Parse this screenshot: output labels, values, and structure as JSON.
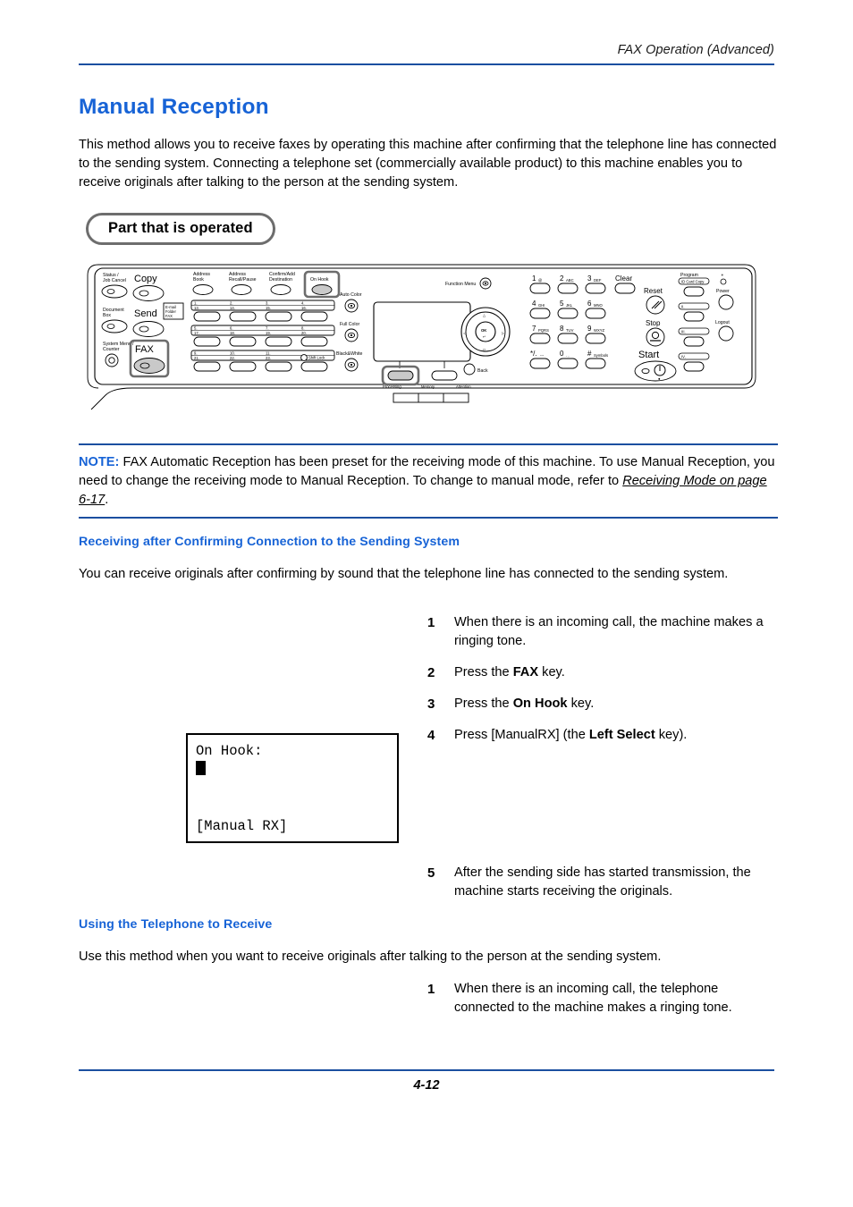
{
  "header": {
    "title": "FAX Operation (Advanced)"
  },
  "page_title": "Manual Reception",
  "intro": "This method allows you to receive faxes by operating this machine after confirming that the telephone line has connected to the sending system. Connecting a telephone set (commercially available product) to this machine enables you to receive originals after talking to the person at the sending system.",
  "callout": {
    "label": "Part that is operated"
  },
  "note": {
    "label": "NOTE:",
    "text_before": " FAX Automatic Reception has been preset for the receiving mode of this machine. To use Manual Reception, you need to change the receiving mode to Manual Reception. To change to manual mode, refer to ",
    "reference": "Receiving Mode on page 6-17",
    "text_after": "."
  },
  "sections": [
    {
      "heading": "Receiving after Confirming Connection to the Sending System",
      "body": "You can receive originals after confirming by sound that the telephone line has connected to the sending system."
    },
    {
      "heading": "Using the Telephone to Receive",
      "body": "Use this method when you want to receive originals after talking to the person at the sending system."
    }
  ],
  "steps_group_1": [
    {
      "num": "1",
      "parts": [
        {
          "text": "When there is an incoming call, the machine makes a ringing tone.",
          "bold": false
        }
      ]
    },
    {
      "num": "2",
      "parts": [
        {
          "text": "Press the ",
          "bold": false
        },
        {
          "text": "FAX",
          "bold": true
        },
        {
          "text": " key.",
          "bold": false
        }
      ]
    },
    {
      "num": "3",
      "parts": [
        {
          "text": "Press the ",
          "bold": false
        },
        {
          "text": "On Hook",
          "bold": true
        },
        {
          "text": " key.",
          "bold": false
        }
      ]
    },
    {
      "num": "4",
      "parts": [
        {
          "text": "Press [ManualRX] (the ",
          "bold": false
        },
        {
          "text": "Left Select",
          "bold": true
        },
        {
          "text": " key).",
          "bold": false
        }
      ]
    }
  ],
  "steps_group_2": [
    {
      "num": "5",
      "parts": [
        {
          "text": "After the sending side has started transmission, the machine starts receiving the originals.",
          "bold": false
        }
      ]
    }
  ],
  "steps_group_3": [
    {
      "num": "1",
      "parts": [
        {
          "text": "When there is an incoming call, the telephone connected to the machine makes a ringing tone.",
          "bold": false
        }
      ]
    }
  ],
  "lcd": {
    "line1": "On Hook:",
    "cursor": true,
    "bottom": "[Manual RX]"
  },
  "control_panel": {
    "labels": {
      "status_job_cancel": "Status /\nJob Cancel",
      "document_box": "Document\nBox",
      "system_menu_counter": "System Menu /\nCounter",
      "copy": "Copy",
      "send": "Send",
      "fax": "FAX",
      "send_tag": "E-mail\nFolder\nFAX",
      "address_book": "Address\nBook",
      "address_recall_pause": "Address\nRecall/Pause",
      "confirm_add_destination": "Confirm/Add\nDestination",
      "on_hook": "On Hook",
      "shift_lock": "Shift Lock",
      "auto_color": "Auto Color",
      "full_color": "Full Color",
      "black_white": "Black&White",
      "processing": "Processing",
      "memory": "Memory",
      "attention": "Attention",
      "function_menu": "Function Menu",
      "ok": "OK",
      "back": "Back",
      "clear": "Clear",
      "reset": "Reset",
      "stop": "Stop",
      "start": "Start",
      "program": "Program",
      "id_card_copy": "ID Card Copy",
      "power": "Power",
      "logout": "Logout"
    },
    "keypad": [
      {
        "digit": "1",
        "sub": "@"
      },
      {
        "digit": "2",
        "sub": "ABC"
      },
      {
        "digit": "3",
        "sub": "DEF"
      },
      {
        "digit": "4",
        "sub": "GHI"
      },
      {
        "digit": "5",
        "sub": "JKL"
      },
      {
        "digit": "6",
        "sub": "MNO"
      },
      {
        "digit": "7",
        "sub": "PQRS"
      },
      {
        "digit": "8",
        "sub": "TUV"
      },
      {
        "digit": "9",
        "sub": "WXYZ"
      },
      {
        "digit": "*/.",
        "sub": "---"
      },
      {
        "digit": "0",
        "sub": ". ,"
      },
      {
        "digit": "#",
        "sub": "Symbols"
      }
    ],
    "one_touch_rows": [
      [
        "1.",
        "2.",
        "3.",
        "4."
      ],
      [
        "13.",
        "14.",
        "15.",
        "16."
      ],
      [
        "5.",
        "6.",
        "7.",
        "8."
      ],
      [
        "17.",
        "18.",
        "19.",
        "20."
      ],
      [
        "9.",
        "10.",
        "11.",
        ""
      ],
      [
        "21.",
        "22.",
        "23.",
        ""
      ]
    ],
    "highlighted_keys": [
      "on-hook-key",
      "fax-key",
      "left-select-key"
    ]
  },
  "footer": {
    "page_number": "4-12"
  },
  "colors": {
    "accent_blue": "#1763d6",
    "rule_blue": "#1b4fa0",
    "highlight_gray": "#6d6d6d",
    "key_fill": "#c9c9c9"
  }
}
